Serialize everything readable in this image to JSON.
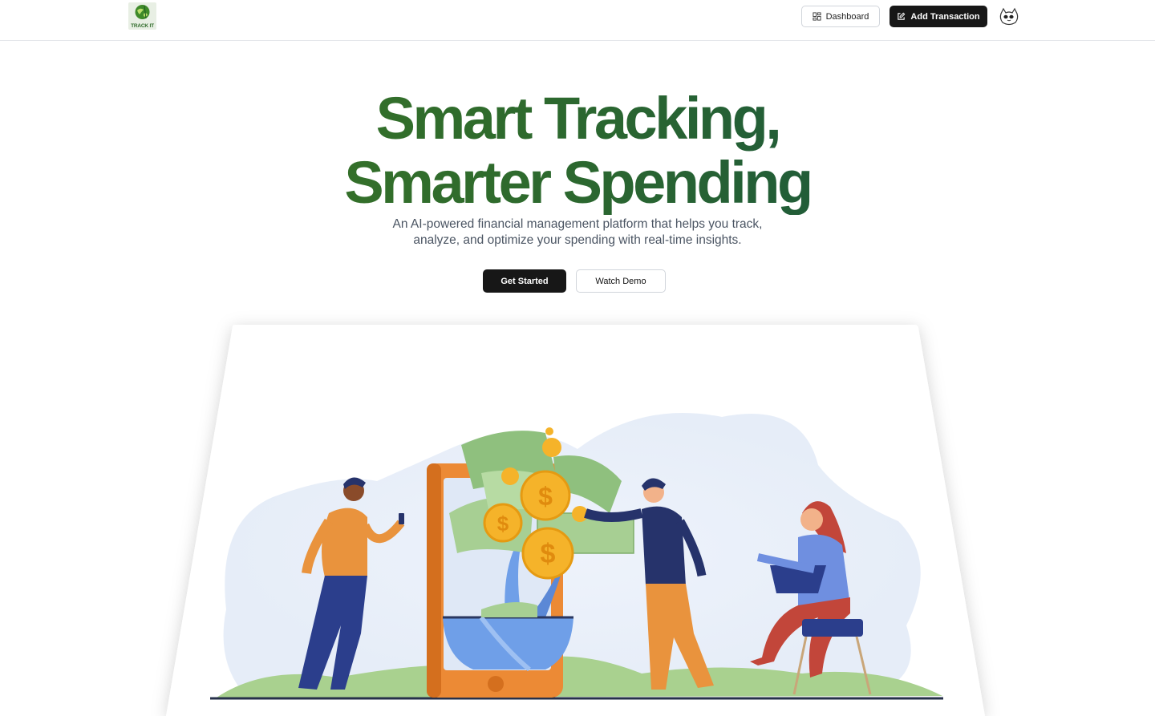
{
  "header": {
    "logo_text": "TRACK IT",
    "dashboard_label": "Dashboard",
    "add_transaction_label": "Add Transaction",
    "icons": {
      "dashboard": "layout-dashboard-icon",
      "add": "pen-square-icon",
      "avatar": "cat-avatar"
    }
  },
  "hero": {
    "title_line1": "Smart Tracking,",
    "title_line2": "Smarter Spending",
    "subtitle_line1": "An AI-powered financial management platform that helps you track,",
    "subtitle_line2": "analyze, and optimize your spending with real-time insights.",
    "get_started_label": "Get Started",
    "watch_demo_label": "Watch Demo"
  },
  "colors": {
    "brand_green": "#2e6a2d",
    "dark_button": "#171717",
    "money_green": "#8fc07e",
    "coin_gold": "#f5b32a",
    "phone_orange": "#ec8a35"
  }
}
